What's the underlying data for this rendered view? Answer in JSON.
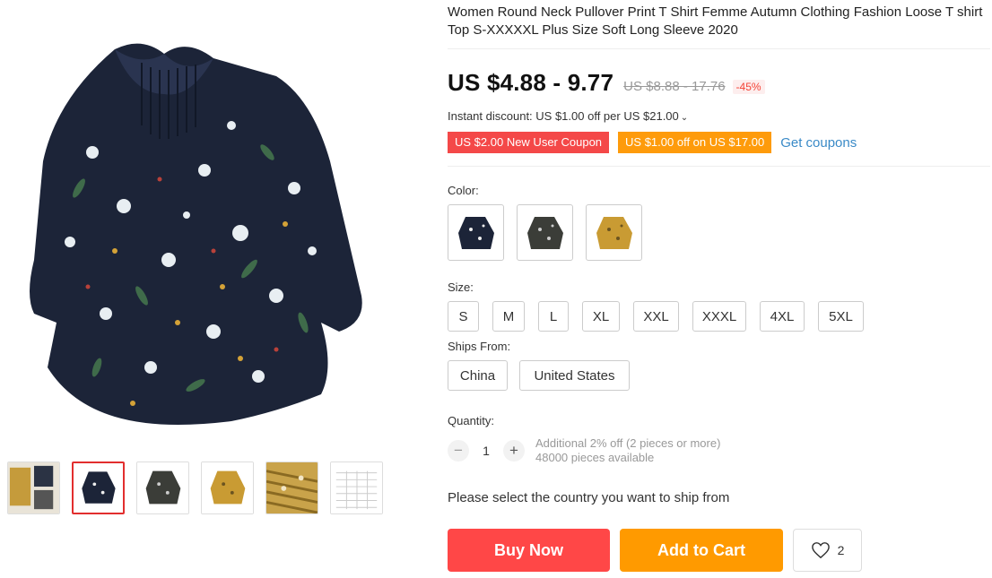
{
  "product": {
    "title": "Women Round Neck Pullover Print T Shirt Femme Autumn Clothing Fashion Loose T shirt Top S-XXXXXL Plus Size Soft Long Sleeve 2020",
    "price": "US $4.88 - 9.77",
    "original_price": "US $8.88 - 17.76",
    "discount": "-45%",
    "instant_discount": "Instant discount: US $1.00 off per US $21.00",
    "coupons": [
      "US $2.00 New User Coupon",
      "US $1.00 off on US $17.00"
    ],
    "get_coupons": "Get coupons"
  },
  "color": {
    "label": "Color:",
    "options": [
      "navy-floral",
      "gray-floral",
      "yellow-floral"
    ]
  },
  "size": {
    "label": "Size:",
    "options": [
      "S",
      "M",
      "L",
      "XL",
      "XXL",
      "XXXL",
      "4XL",
      "5XL"
    ]
  },
  "ships_from": {
    "label": "Ships From:",
    "options": [
      "China",
      "United States"
    ]
  },
  "quantity": {
    "label": "Quantity:",
    "minus": "−",
    "value": "1",
    "plus": "+",
    "extra_discount": "Additional 2% off (2 pieces or more)",
    "available": "48000 pieces available"
  },
  "ship_message": "Please select the country you want to ship from",
  "actions": {
    "buy_now": "Buy Now",
    "add_to_cart": "Add to Cart",
    "wishlist_count": "2"
  },
  "colors": {
    "accent_red": "#ff4747",
    "accent_orange": "#ff9a00",
    "link_blue": "#3a8ac7"
  }
}
